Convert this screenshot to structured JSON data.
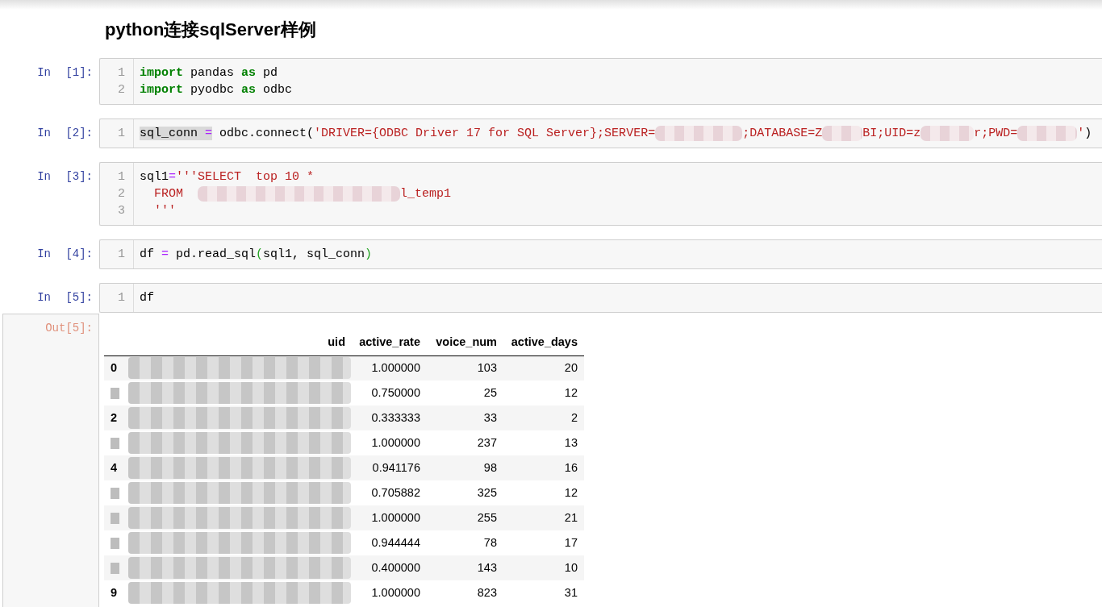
{
  "title": "python连接sqlServer样例",
  "cells": [
    {
      "prompt": "In [1]:",
      "lines": [
        {
          "number": "1",
          "segments": [
            {
              "text": "import",
              "kind": "keyword",
              "highlighted": false
            },
            {
              "text": " pandas ",
              "kind": "plain",
              "highlighted": false
            },
            {
              "text": "as",
              "kind": "keyword",
              "highlighted": false
            },
            {
              "text": " pd",
              "kind": "plain",
              "highlighted": false
            }
          ]
        },
        {
          "number": "2",
          "segments": [
            {
              "text": "import",
              "kind": "keyword",
              "highlighted": false
            },
            {
              "text": " pyodbc ",
              "kind": "plain",
              "highlighted": false
            },
            {
              "text": "as",
              "kind": "keyword",
              "highlighted": false
            },
            {
              "text": " odbc",
              "kind": "plain",
              "highlighted": false
            }
          ]
        }
      ]
    },
    {
      "prompt": "In [2]:",
      "lines": [
        {
          "number": "1",
          "segments": [
            {
              "text": "sql_conn ",
              "kind": "plain",
              "highlighted": true
            },
            {
              "text": "=",
              "kind": "operator",
              "highlighted": true
            },
            {
              "text": " odbc.connect(",
              "kind": "plain",
              "highlighted": false
            },
            {
              "text": "'DRIVER={ODBC Driver 17 for SQL Server};SERVER=",
              "kind": "string",
              "highlighted": false
            },
            {
              "kind": "redacted"
            },
            {
              "text": ";DATABASE=Z",
              "kind": "string",
              "highlighted": false
            },
            {
              "kind": "redacted"
            },
            {
              "text": "BI;UID=z",
              "kind": "string",
              "highlighted": false
            },
            {
              "kind": "redacted"
            },
            {
              "text": "r;PWD=",
              "kind": "string",
              "highlighted": false
            },
            {
              "kind": "redacted"
            },
            {
              "text": "'",
              "kind": "string",
              "highlighted": false
            },
            {
              "text": ")",
              "kind": "plain",
              "highlighted": false
            }
          ]
        }
      ]
    },
    {
      "prompt": "In [3]:",
      "lines": [
        {
          "number": "1",
          "segments": [
            {
              "text": "sql1",
              "kind": "plain",
              "highlighted": false
            },
            {
              "text": "=",
              "kind": "operator",
              "highlighted": false
            },
            {
              "text": "'''SELECT  top 10 *",
              "kind": "string",
              "highlighted": false
            }
          ]
        },
        {
          "number": "2",
          "segments": [
            {
              "text": "  FROM  ",
              "kind": "string",
              "highlighted": false
            },
            {
              "kind": "redacted"
            },
            {
              "text": "l_temp1",
              "kind": "string",
              "highlighted": false
            }
          ]
        },
        {
          "number": "3",
          "segments": [
            {
              "text": "  '''",
              "kind": "string",
              "highlighted": false
            }
          ]
        }
      ]
    },
    {
      "prompt": "In [4]:",
      "lines": [
        {
          "number": "1",
          "segments": [
            {
              "text": "df ",
              "kind": "plain",
              "highlighted": false
            },
            {
              "text": "=",
              "kind": "operator",
              "highlighted": false
            },
            {
              "text": " pd.read_sql",
              "kind": "plain",
              "highlighted": false
            },
            {
              "text": "(",
              "kind": "bracket",
              "highlighted": false
            },
            {
              "text": "sql1, sql_conn",
              "kind": "plain",
              "highlighted": false
            },
            {
              "text": ")",
              "kind": "bracket",
              "highlighted": false
            }
          ]
        }
      ]
    },
    {
      "prompt": "In [5]:",
      "lines": [
        {
          "number": "1",
          "segments": [
            {
              "text": "df",
              "kind": "plain",
              "highlighted": false
            }
          ]
        }
      ]
    }
  ],
  "output": {
    "prompt": "Out[5]:",
    "table": {
      "columns": [
        "uid",
        "active_rate",
        "voice_num",
        "active_days"
      ],
      "rows": [
        {
          "index": "0",
          "index_redacted": false,
          "uid_redacted": true,
          "values": [
            "1.000000",
            "103",
            "20"
          ]
        },
        {
          "index_redacted": true,
          "uid_redacted": true,
          "values": [
            "0.750000",
            "25",
            "12"
          ]
        },
        {
          "index": "2",
          "index_redacted": false,
          "uid_redacted": true,
          "values": [
            "0.333333",
            "33",
            "2"
          ]
        },
        {
          "index_redacted": true,
          "uid_redacted": true,
          "values": [
            "1.000000",
            "237",
            "13"
          ]
        },
        {
          "index": "4",
          "index_redacted": false,
          "uid_redacted": true,
          "values": [
            "0.941176",
            "98",
            "16"
          ]
        },
        {
          "index_redacted": true,
          "uid_redacted": true,
          "values": [
            "0.705882",
            "325",
            "12"
          ]
        },
        {
          "index_redacted": true,
          "uid_redacted": true,
          "values": [
            "1.000000",
            "255",
            "21"
          ]
        },
        {
          "index_redacted": true,
          "uid_redacted": true,
          "values": [
            "0.944444",
            "78",
            "17"
          ]
        },
        {
          "index_redacted": true,
          "uid_redacted": true,
          "values": [
            "0.400000",
            "143",
            "10"
          ]
        },
        {
          "index": "9",
          "index_redacted": false,
          "uid_redacted": true,
          "values": [
            "1.000000",
            "823",
            "31"
          ]
        }
      ]
    }
  }
}
